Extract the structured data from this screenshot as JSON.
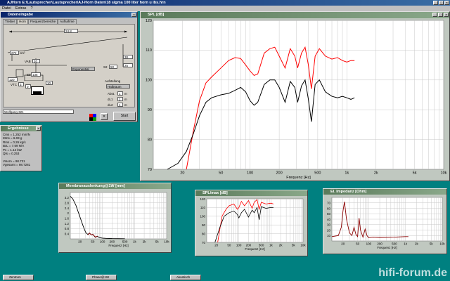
{
  "app": {
    "title": "AJHorn  E:\\Lautsprecher\\Lautsprecher\\AJ-Horn Daten\\18 sigma 100 liter horn u ibs.hrn",
    "menu": [
      "Datei",
      "Extras",
      "?"
    ]
  },
  "input_window": {
    "title": "Dateneingabe",
    "tabs": [
      "Treiber",
      "Horn",
      "Frequenzbereiche",
      "Aufnahme"
    ],
    "fields": {
      "top_len": "24.8",
      "s1_top": "272",
      "vab": "20",
      "s_left": "120",
      "s2": "3",
      "r_top": "30",
      "r_bot": "25",
      "s0": "135",
      "vtc": "3",
      "l1": "0",
      "l2": "10",
      "s2r": "50",
      "profile": "Exponential",
      "footer": "Wolfgang 321"
    },
    "labels": {
      "l1": "l1",
      "s0": "S0",
      "vab": "VAB",
      "sr": "S2",
      "s1": "S1",
      "cm": "cm",
      "cm2": "cm²",
      "vtc": "VTC"
    },
    "aufstellung": {
      "title": "Aufstellung",
      "select": "Halbraum",
      "rows": [
        {
          "label": "Abst.",
          "value": "1",
          "unit": "m"
        },
        {
          "label": "dL1",
          "value": "1",
          "unit": "m"
        },
        {
          "label": "dL2",
          "value": "1",
          "unit": "m"
        }
      ]
    },
    "start_label": "Start"
  },
  "main_chart": {
    "title": "SPL [dB]"
  },
  "results": {
    "title": "Ergebnisse",
    "lines": [
      "Cms = 1.252 mm/N",
      "Mms = 6.03 g",
      "Rms = 0.26 kg/s",
      "BxL = 7.69 N/A",
      "Ps = 1.14 kW",
      "Qts = 0.253",
      "",
      "VHorn = 98.731",
      "Vgesamt = 98.7281"
    ]
  },
  "excursion": {
    "title": "Membranauslenkung@1W [mm]",
    "xlabel": "Frequenz [Hz]"
  },
  "spl_chart": {
    "title": "SPL/max [dB]",
    "xlabel": "Frequenz [Hz]"
  },
  "impedance": {
    "title": "El. Impedanz [Ohm]",
    "xlabel": "Frequenz [Hz]"
  },
  "taskbar": [
    "Zentrum",
    "Phase@1W",
    "Akustisch"
  ],
  "watermark": "hifi-forum.de",
  "chart_data": [
    {
      "type": "line",
      "title": "SPL [dB]",
      "xlabel": "Frequenz [Hz]",
      "ylabel": "",
      "xscale": "log",
      "xlim": [
        10,
        10000
      ],
      "ylim": [
        70,
        120
      ],
      "xticks": [
        10,
        20,
        50,
        100,
        200,
        500,
        1000,
        2000,
        5000,
        10000
      ],
      "xticklabels": [
        "",
        "20",
        "50",
        "100",
        "200",
        "500",
        "1k",
        "2k",
        "5k",
        "10k"
      ],
      "yticks": [
        70,
        80,
        90,
        100,
        110,
        120
      ],
      "yticklabels": [
        "70",
        "80",
        "90",
        "100",
        "110",
        "120"
      ],
      "grid": true,
      "series": [
        {
          "color": "#ff0000",
          "x": [
            22,
            26,
            30,
            35,
            40,
            50,
            60,
            70,
            80,
            90,
            100,
            110,
            120,
            140,
            160,
            180,
            200,
            230,
            260,
            290,
            310,
            340,
            370,
            400,
            430,
            470,
            520,
            600,
            700,
            800,
            900,
            1000,
            1100,
            1200
          ],
          "y": [
            70,
            83,
            93,
            99,
            101,
            104,
            106.5,
            107.5,
            107.2,
            105,
            103,
            101.5,
            102,
            109,
            110.5,
            111,
            108,
            104,
            110.5,
            108,
            104,
            109,
            111,
            105,
            97,
            108,
            110.5,
            108,
            107,
            107.5,
            106.5,
            106,
            106.5,
            106.5
          ]
        },
        {
          "color": "#000000",
          "x": [
            14,
            18,
            22,
            26,
            30,
            35,
            40,
            50,
            60,
            70,
            80,
            90,
            100,
            110,
            120,
            140,
            160,
            180,
            200,
            230,
            260,
            290,
            310,
            340,
            370,
            400,
            430,
            470,
            520,
            600,
            700,
            800,
            900,
            1000,
            1100,
            1200
          ],
          "y": [
            70,
            72,
            76,
            82,
            88,
            92.5,
            94,
            95,
            95.5,
            96.5,
            97.5,
            96,
            93,
            91.5,
            92.5,
            98.5,
            100,
            100,
            97.5,
            92.5,
            99.5,
            97.5,
            92.5,
            98,
            100,
            93.5,
            86,
            98.5,
            100,
            96,
            94.5,
            94,
            94.5,
            94,
            93.5,
            94
          ]
        }
      ]
    },
    {
      "type": "line",
      "title": "Membranauslenkung@1W [mm]",
      "xlabel": "Frequenz [Hz]",
      "xscale": "log",
      "xlim": [
        10,
        10000
      ],
      "ylim": [
        0,
        3.6
      ],
      "xticklabels": [
        "20",
        "50",
        "100",
        "200",
        "500",
        "1k",
        "2k",
        "5k",
        "10k"
      ],
      "yticklabels": [
        "0.4",
        "0.8",
        "1.2",
        "1.6",
        "2",
        "2.4",
        "2.8",
        "3.2"
      ],
      "series": [
        {
          "color": "#000000",
          "x": [
            10,
            12,
            15,
            20,
            25,
            30,
            35,
            40,
            45,
            50,
            60,
            70,
            80,
            100,
            130,
            200,
            500
          ],
          "y": [
            3.3,
            3.1,
            2.6,
            1.7,
            1.0,
            0.5,
            0.35,
            0.45,
            0.3,
            0.35,
            0.12,
            0.2,
            0.1,
            0.06,
            0.04,
            0.02,
            0.01
          ]
        },
        {
          "color": "#8b0000",
          "x": [
            35,
            40,
            45,
            50,
            60,
            70
          ],
          "y": [
            0.3,
            0.45,
            0.3,
            0.36,
            0.15,
            0.2
          ]
        }
      ]
    },
    {
      "type": "line",
      "title": "SPL/max [dB]",
      "xlabel": "Frequenz [Hz]",
      "xscale": "log",
      "xlim": [
        10,
        10000
      ],
      "ylim": [
        70,
        120
      ],
      "xticklabels": [
        "20",
        "50",
        "100",
        "200",
        "500",
        "1k",
        "2k",
        "5k",
        "10k"
      ],
      "yticklabels": [
        "70",
        "80",
        "90",
        "100",
        "110",
        "120"
      ],
      "series": [
        {
          "color": "#ff0000",
          "x": [
            22,
            30,
            40,
            50,
            70,
            90,
            100,
            120,
            150,
            200,
            260,
            300,
            370,
            430,
            500,
            700,
            1000,
            1200
          ],
          "y": [
            70,
            100,
            108,
            112,
            114,
            108,
            110,
            117,
            112,
            118,
            109,
            116,
            119,
            108,
            116,
            114,
            115,
            114
          ]
        },
        {
          "color": "#000000",
          "x": [
            18,
            26,
            35,
            50,
            70,
            90,
            100,
            120,
            150,
            200,
            260,
            300,
            370,
            430,
            500,
            700,
            1000,
            1200
          ],
          "y": [
            70,
            88,
            100,
            104,
            106,
            102,
            98,
            104,
            108,
            99,
            107,
            104,
            110,
            96,
            111,
            109,
            110,
            110
          ]
        }
      ]
    },
    {
      "type": "line",
      "title": "El. Impedanz [Ohm]",
      "xlabel": "Frequenz [Hz]",
      "xscale": "log",
      "xlim": [
        10,
        10000
      ],
      "ylim": [
        0,
        80
      ],
      "xticklabels": [
        "20",
        "50",
        "100",
        "200",
        "500",
        "1k",
        "2k",
        "5k",
        "10k"
      ],
      "yticklabels": [
        "10",
        "20",
        "30",
        "40",
        "50",
        "60",
        "70"
      ],
      "series": [
        {
          "color": "#8b0000",
          "x": [
            10,
            15,
            18,
            20,
            22,
            25,
            30,
            35,
            40,
            45,
            50,
            55,
            60,
            70,
            80,
            90,
            100,
            130,
            200,
            500,
            1000,
            1200
          ],
          "y": [
            8,
            10,
            25,
            55,
            72,
            40,
            15,
            10,
            25,
            12,
            8,
            42,
            20,
            7,
            22,
            10,
            6,
            7,
            6.5,
            7,
            8,
            8
          ]
        }
      ]
    }
  ]
}
